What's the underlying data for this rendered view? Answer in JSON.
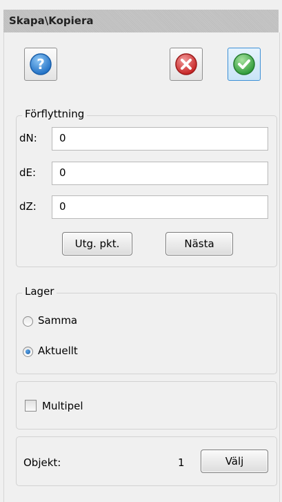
{
  "window": {
    "title": "Skapa\\Kopiera"
  },
  "toolbar": {
    "help_icon": "question-icon",
    "cancel_icon": "cancel-x-icon",
    "ok_icon": "confirm-check-icon",
    "colors": {
      "help": "#2f7fd0",
      "cancel": "#d23a3a",
      "ok": "#3bb34a",
      "active_border": "#3c8fd6"
    }
  },
  "displacement": {
    "legend": "Förflyttning",
    "fields": [
      {
        "label": "dN:",
        "value": "0"
      },
      {
        "label": "dE:",
        "value": "0"
      },
      {
        "label": "dZ:",
        "value": "0"
      }
    ],
    "origin_button": "Utg. pkt.",
    "next_button": "Nästa"
  },
  "layer": {
    "legend": "Lager",
    "options": [
      {
        "label": "Samma",
        "selected": false
      },
      {
        "label": "Aktuellt",
        "selected": true
      }
    ]
  },
  "multiple": {
    "label": "Multipel",
    "checked": false
  },
  "objects": {
    "label": "Objekt:",
    "count": "1",
    "select_button": "Välj"
  }
}
